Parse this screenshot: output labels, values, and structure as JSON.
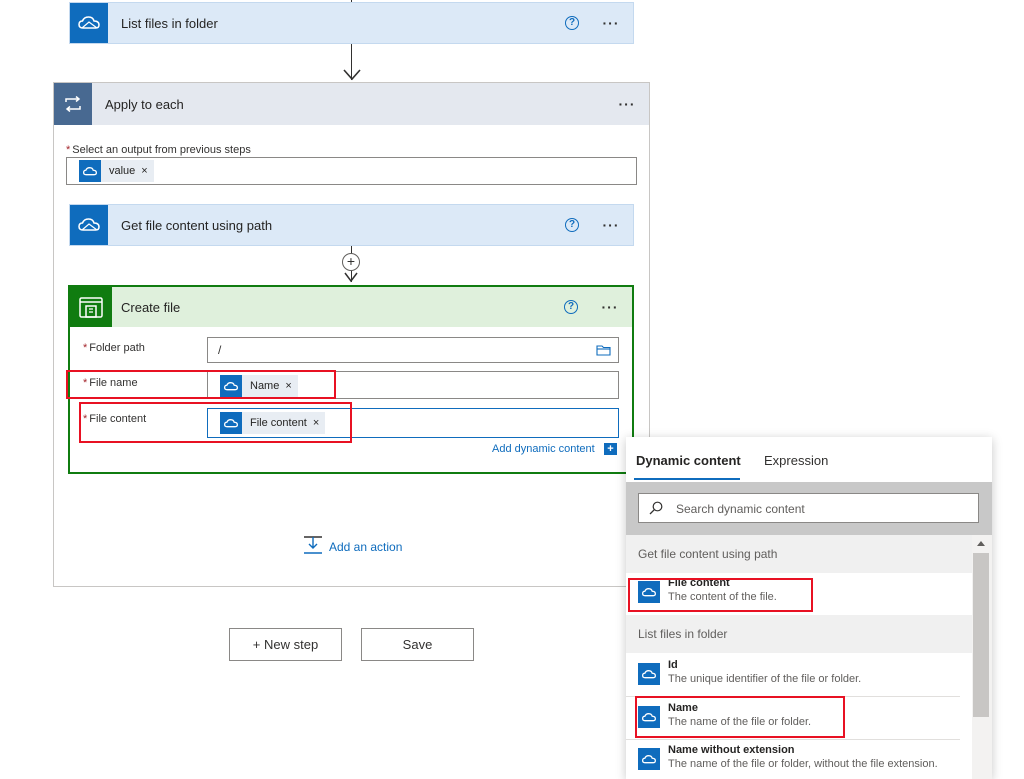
{
  "list_files_step": {
    "title": "List files in folder",
    "help": "?",
    "more": "···"
  },
  "apply_each": {
    "title": "Apply to each",
    "more": "···",
    "select_label": "Select an output from previous steps",
    "value_token": "value",
    "token_remove": "×"
  },
  "get_file_step": {
    "title": "Get file content using path",
    "help": "?",
    "more": "···"
  },
  "insert_plus": "+",
  "create_file": {
    "title": "Create file",
    "help": "?",
    "more": "···",
    "folder_path_label": "Folder path",
    "folder_path_value": "/",
    "file_name_label": "File name",
    "file_name_token": "Name",
    "file_content_label": "File content",
    "file_content_token": "File content",
    "token_remove": "×",
    "required_mark": "*",
    "add_dynamic": "Add dynamic content",
    "add_dynamic_icon": "+"
  },
  "add_action": {
    "label": "Add an action"
  },
  "footer": {
    "new_step": "+ New step",
    "save": "Save"
  },
  "dynamic_panel": {
    "tab_dynamic": "Dynamic content",
    "tab_expression": "Expression",
    "search_placeholder": "Search dynamic content",
    "groups": [
      {
        "title": "Get file content using path",
        "items": [
          {
            "name": "File content",
            "desc": "The content of the file."
          }
        ]
      },
      {
        "title": "List files in folder",
        "items": [
          {
            "name": "Id",
            "desc": "The unique identifier of the file or folder."
          },
          {
            "name": "Name",
            "desc": "The name of the file or folder."
          },
          {
            "name": "Name without extension",
            "desc": "The name of the file or folder, without the file extension."
          }
        ]
      }
    ]
  },
  "colors": {
    "onedrive_blue": "#0f6cbd",
    "apply_each_header": "#e4e8ef",
    "create_file_border": "#107c10",
    "create_file_header": "#dff0dc",
    "highlight_red": "#e81123",
    "link_blue": "#0f6cbd"
  },
  "icons": {
    "onedrive": "onedrive-cloud-icon",
    "loop": "loop-icon",
    "file_system": "file-system-icon",
    "folder": "folder-icon",
    "search": "search-icon",
    "add_action": "add-action-icon"
  }
}
